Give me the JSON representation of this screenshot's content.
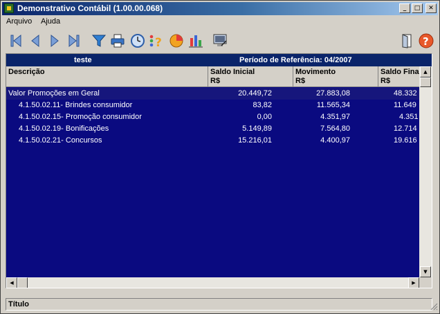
{
  "window": {
    "title": "Demonstrativo Contábil (1.00.00.068)",
    "minimize_glyph": "_",
    "maximize_glyph": "□",
    "close_glyph": "✕"
  },
  "menu": [
    "Arquivo",
    "Ajuda"
  ],
  "toolbar": {
    "icons": [
      "first-record-icon",
      "previous-record-icon",
      "next-record-icon",
      "last-record-icon",
      "filter-icon",
      "print-icon",
      "clock-icon",
      "query-icon",
      "pie-chart-icon",
      "bar-chart-icon",
      "screen-icon",
      "exit-door-icon",
      "help-icon"
    ]
  },
  "report": {
    "title": "teste",
    "period": "Período de Referência: 04/2007",
    "columns": [
      {
        "label": "Descrição",
        "unit": ""
      },
      {
        "label": "Saldo Inicial",
        "unit": "R$"
      },
      {
        "label": "Movimento",
        "unit": "R$"
      },
      {
        "label": "Saldo Fina",
        "unit": "R$"
      }
    ],
    "rows": [
      {
        "desc": "Valor Promoções em Geral",
        "saldo_inicial": "20.449,72",
        "movimento": "27.883,08",
        "saldo_final": "48.332"
      },
      {
        "desc": "4.1.50.02.11- Brindes consumidor",
        "saldo_inicial": "83,82",
        "movimento": "11.565,34",
        "saldo_final": "11.649"
      },
      {
        "desc": "4.1.50.02.15- Promoção consumidor",
        "saldo_inicial": "0,00",
        "movimento": "4.351,97",
        "saldo_final": "4.351"
      },
      {
        "desc": "4.1.50.02.19- Bonificações",
        "saldo_inicial": "5.149,89",
        "movimento": "7.564,80",
        "saldo_final": "12.714"
      },
      {
        "desc": "4.1.50.02.21- Concursos",
        "saldo_inicial": "15.216,01",
        "movimento": "4.400,97",
        "saldo_final": "19.616"
      }
    ]
  },
  "status": {
    "label": "Título"
  },
  "colors": {
    "grid_bg": "#0a0a80",
    "header_bg": "#0a246a",
    "selected_row": "#16167c",
    "chrome": "#d4d0c8"
  }
}
